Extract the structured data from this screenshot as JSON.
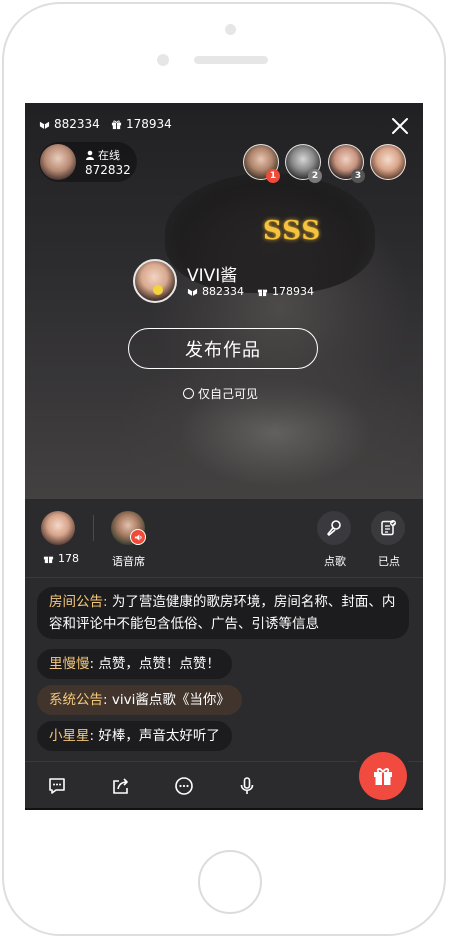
{
  "header": {
    "likes_count": "882334",
    "gifts_count": "178934"
  },
  "online": {
    "label": "在线",
    "count": "872832"
  },
  "rank_badges": [
    "1",
    "2",
    "3"
  ],
  "effect_text": "SSS",
  "host": {
    "name": "VIVI酱",
    "likes_count": "882334",
    "gifts_count": "178934"
  },
  "publish_button": "发布作品",
  "private_option": "仅自己可见",
  "seats": {
    "gift_count": "178",
    "voice_seat_label": "语音席"
  },
  "actions": {
    "request_song": "点歌",
    "requested": "已点"
  },
  "chat": [
    {
      "name": "房间公告",
      "sep": ": ",
      "text": "为了营造健康的歌房环境，房间名称、封面、内容和评论中不能包含低俗、广告、引诱等信息",
      "type": "announcement"
    },
    {
      "name": "里慢慢",
      "sep": ": ",
      "text": "点赞，点赞！点赞！",
      "type": "user"
    },
    {
      "name": "系统公告",
      "sep": ": ",
      "text": "vivi酱点歌《当你》",
      "type": "system"
    },
    {
      "name": "小星星",
      "sep": ": ",
      "text": "好棒，声音太好听了",
      "type": "user"
    }
  ],
  "colors": {
    "accent": "#f14a3e",
    "name_highlight": "#f2c77c",
    "background": "#2b2b2e"
  },
  "icons": [
    "likes-icon",
    "gift-icon",
    "close-icon",
    "user-icon",
    "microphone-icon",
    "checklist-icon",
    "comment-icon",
    "share-icon",
    "more-icon",
    "voice-icon",
    "gift-box-icon"
  ]
}
